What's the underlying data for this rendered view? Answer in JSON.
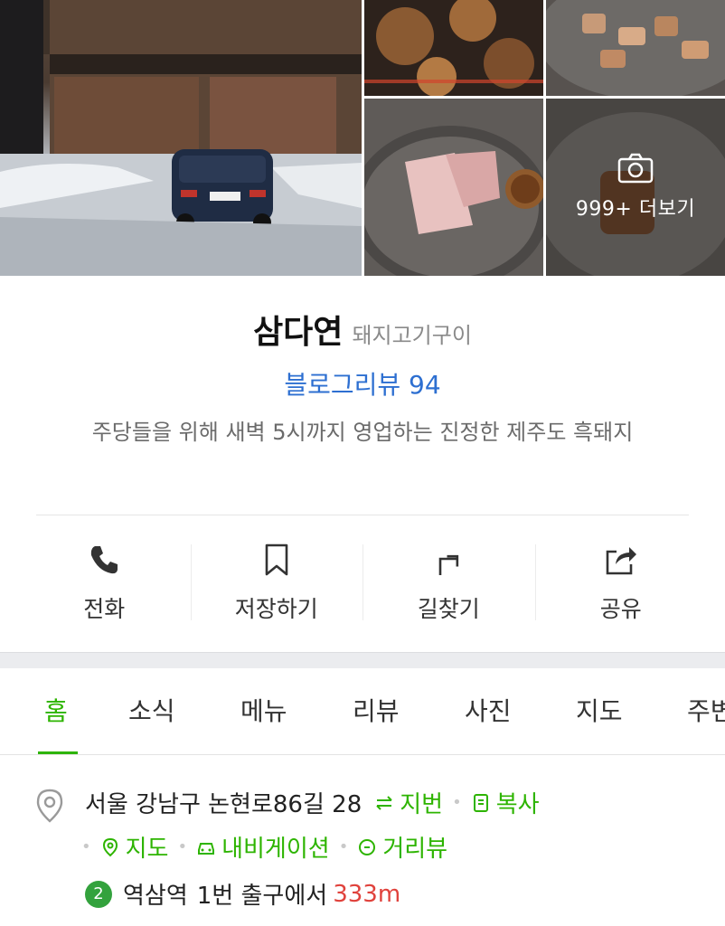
{
  "photos": {
    "more_count": "999+ 더보기"
  },
  "place": {
    "name": "삼다연",
    "category": "돼지고기구이",
    "blog_review": "블로그리뷰 94",
    "description": "주당들을 위해 새벽 5시까지 영업하는 진정한 제주도 흑돼지"
  },
  "actions": [
    {
      "label": "전화",
      "icon": "phone-icon"
    },
    {
      "label": "저장하기",
      "icon": "bookmark-icon"
    },
    {
      "label": "길찾기",
      "icon": "directions-icon"
    },
    {
      "label": "공유",
      "icon": "share-icon"
    }
  ],
  "tabs": [
    {
      "label": "홈",
      "active": true
    },
    {
      "label": "소식"
    },
    {
      "label": "메뉴"
    },
    {
      "label": "리뷰"
    },
    {
      "label": "사진"
    },
    {
      "label": "지도"
    },
    {
      "label": "주변"
    }
  ],
  "info": {
    "address": "서울 강남구 논현로86길 28",
    "jibun_link": "지번",
    "copy_link": "복사",
    "map_link": "지도",
    "navigation_link": "내비게이션",
    "streetview_link": "거리뷰",
    "subway_line": "2",
    "station": "역삼역",
    "exit_text": "1번 출구에서",
    "distance": "333m"
  },
  "colors": {
    "accent_green": "#2db400",
    "review_blue": "#2d6fd1",
    "distance_red": "#e0423c",
    "line2_green": "#33a23d"
  }
}
